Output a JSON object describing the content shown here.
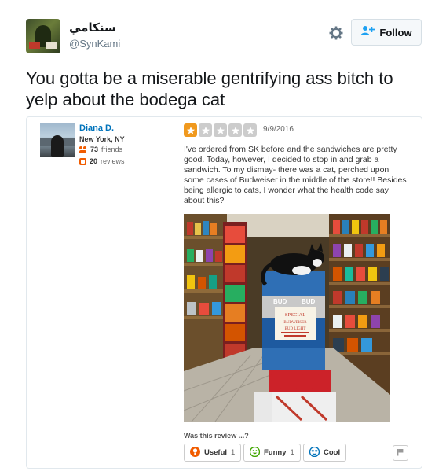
{
  "tweet": {
    "user_name": "سنكامي",
    "user_handle": "@SynKami",
    "follow_label": "Follow",
    "text": "You gotta be a miserable gentrifying ass bitch to yelp about the bodega cat"
  },
  "review": {
    "reviewer_name": "Diana D.",
    "reviewer_location": "New York, NY",
    "friends_count": "73",
    "friends_label": "friends",
    "reviews_count": "20",
    "reviews_label": "reviews",
    "rating": 1,
    "rating_max": 5,
    "date": "9/9/2016",
    "text": "I've ordered from SK before and the sandwiches are pretty good. Today, however, I decided to stop in and grab a sandwich. To my dismay- there was a cat, perched upon some cases of Budweiser in the middle of the store!! Besides being allergic to cats, I wonder what the health code say about this?",
    "photo": {
      "box_brand": "BUD",
      "sign_lines": [
        "SPECIAL",
        "BUDWEISER",
        "BUD LIGHT"
      ]
    },
    "was_this_label": "Was this review ...?",
    "votes": {
      "useful_label": "Useful",
      "useful_count": "1",
      "funny_label": "Funny",
      "funny_count": "1",
      "cool_label": "Cool"
    }
  },
  "colors": {
    "yelp_red": "#f15c00",
    "star_on": "#f0991e",
    "star_off": "#cccccc",
    "link_blue": "#0073bb",
    "twitter_blue": "#1da1f2"
  },
  "icons": [
    "gear-icon",
    "add-user-icon",
    "friends-icon",
    "reviews-icon",
    "star-icon",
    "useful-icon",
    "funny-icon",
    "cool-icon",
    "flag-icon"
  ]
}
